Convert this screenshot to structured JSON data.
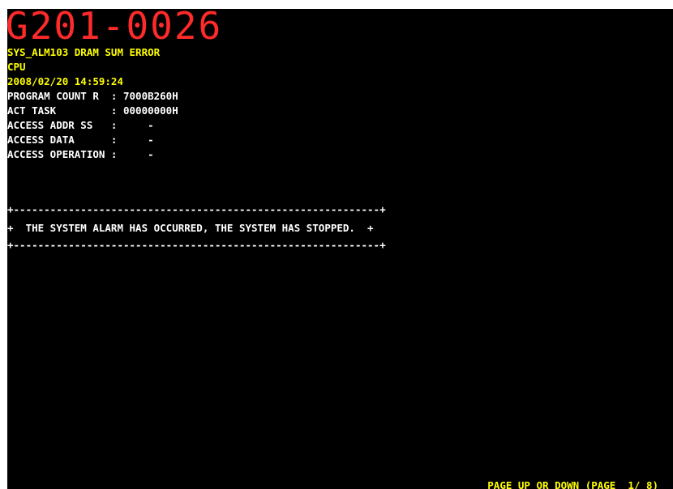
{
  "alarm_code": "G201-0026",
  "alarm_title": "SYS_ALM103 DRAM SUM ERROR",
  "source": "CPU",
  "timestamp": "2008/02/20 14:59:24",
  "details": [
    "PROGRAM COUNT R  : 7000B260H",
    "ACT TASK         : 00000000H",
    "ACCESS ADDR SS   :     -",
    "ACCESS DATA      :     -",
    "ACCESS OPERATION :     -"
  ],
  "banner": {
    "border_top": "+------------------------------------------------------------+",
    "message": "+  THE SYSTEM ALARM HAS OCCURRED, THE SYSTEM HAS STOPPED.  +",
    "border_bottom": "+------------------------------------------------------------+"
  },
  "footer": "PAGE UP OR DOWN (PAGE  1/ 8)",
  "colors": {
    "background": "#000000",
    "alarm_code": "#ff2a2a",
    "header_text": "#ffff00",
    "detail_text": "#ffffff"
  }
}
